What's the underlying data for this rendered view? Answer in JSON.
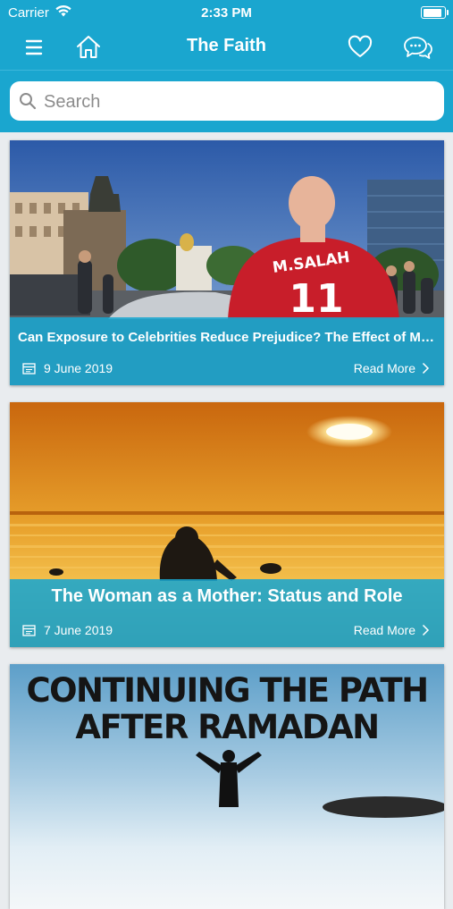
{
  "status_bar": {
    "carrier": "Carrier",
    "time": "2:33 PM"
  },
  "nav": {
    "title": "The Faith",
    "icons": [
      "menu-icon",
      "home-icon",
      "heart-icon",
      "chat-icon"
    ]
  },
  "search": {
    "placeholder": "Search",
    "value": "",
    "icon": "search-icon"
  },
  "articles": [
    {
      "title": "Can Exposure to Celebrities Reduce Prejudice? The Effect of Mohamed Salah on Islamophobic Behaviors and Attitudes",
      "date": "9 June 2019",
      "read_more": "Read More",
      "jersey_name": "M.SALAH",
      "jersey_number": "11"
    },
    {
      "title": "The Woman as a Mother: Status and Role",
      "date": "7 June 2019",
      "read_more": "Read More"
    },
    {
      "title": "",
      "image_text_line1": "CONTINUING THE PATH",
      "image_text_line2": "AFTER RAMADAN"
    }
  ],
  "colors": {
    "accent": "#1aa6cf",
    "background": "#e9ecef"
  }
}
